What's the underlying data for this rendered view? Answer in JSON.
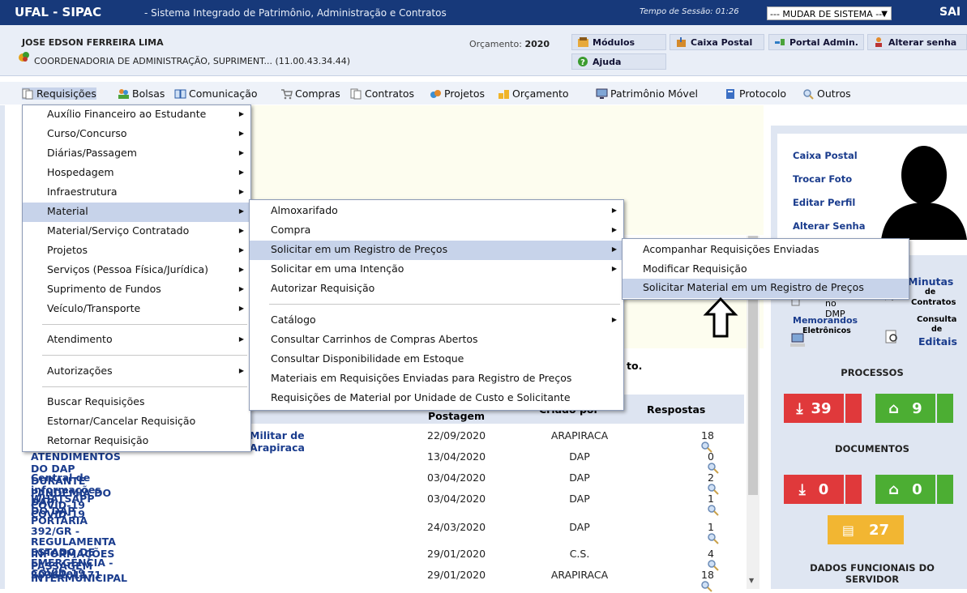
{
  "topbar": {
    "title": "UFAL - SIPAC",
    "subtitle": "- Sistema Integrado de Patrimônio, Administração e Contratos",
    "session": "Tempo de Sessão: 01:26",
    "system_select": "--- MUDAR DE SISTEMA ---",
    "exit": "SAI"
  },
  "user": {
    "name": "JOSE EDSON FERREIRA LIMA",
    "unit": "COORDENADORIA DE ADMINISTRAÇÃO, SUPRIMENT... (11.00.43.34.44)",
    "budget_label": "Orçamento:",
    "budget_year": "2020"
  },
  "toolbar": {
    "modulos": "Módulos",
    "caixa_postal": "Caixa Postal",
    "portal_admin": "Portal Admin.",
    "alterar_senha": "Alterar senha",
    "ajuda": "Ajuda"
  },
  "menubar": [
    "Requisições",
    "Bolsas",
    "Comunicação",
    "Compras",
    "Contratos",
    "Projetos",
    "Orçamento",
    "Patrimônio Móvel",
    "Protocolo",
    "Outros"
  ],
  "menu1": [
    "Auxílio Financeiro ao Estudante",
    "Curso/Concurso",
    "Diárias/Passagem",
    "Hospedagem",
    "Infraestrutura",
    "Material",
    "Material/Serviço Contratado",
    "Projetos",
    "Serviços (Pessoa Física/Jurídica)",
    "Suprimento de Fundos",
    "Veículo/Transporte",
    "Atendimento",
    "Autorizações",
    "Buscar Requisições",
    "Estornar/Cancelar Requisição",
    "Retornar Requisição"
  ],
  "menu2": [
    "Almoxarifado",
    "Compra",
    "Solicitar em um Registro de Preços",
    "Solicitar em uma Intenção",
    "Autorizar Requisição",
    "Catálogo",
    "Consultar Carrinhos de Compras Abertos",
    "Consultar Disponibilidade em Estoque",
    "Materiais em Requisições Enviadas para Registro de Preços",
    "Requisições de Material por Unidade de Custo e Solicitante"
  ],
  "menu3": [
    "Acompanhar Requisições Enviadas",
    "Modificar Requisição",
    "Solicitar Material em um Registro de Preços"
  ],
  "content": {
    "partial_text": "to.",
    "headers": {
      "postagem": "Postagem",
      "criado_por": "Criado por",
      "respostas": "Respostas"
    },
    "rows": [
      {
        "title": "Militar de Arapiraca",
        "date": "22/09/2020",
        "by": "ARAPIRACA",
        "replies": "18"
      },
      {
        "title": "ATENDIMENTOS DO DAP DURANTE PANDEMIA DO COVID-19",
        "date": "13/04/2020",
        "by": "DAP",
        "replies": "0"
      },
      {
        "title": "Central de informações DAP - COVID-19",
        "date": "03/04/2020",
        "by": "DAP",
        "replies": "2"
      },
      {
        "title": "WHATSAPP DO DAP",
        "date": "03/04/2020",
        "by": "DAP",
        "replies": "1"
      },
      {
        "title": "PORTARIA 392/GR - REGULAMENTA ESTADO DE",
        "title2": "EMERGÊNCIA - COVID-19",
        "date": "24/03/2020",
        "by": "DAP",
        "replies": "1"
      },
      {
        "title": "INFORMAÇÕES PASSAGEM INTERMUNICIPAL",
        "date": "29/01/2020",
        "by": "C.S.",
        "replies": "4"
      },
      {
        "title": "3036101171",
        "date": "29/01/2020",
        "by": "ARAPIRACA",
        "replies": "18"
      }
    ]
  },
  "right": {
    "links": [
      "Caixa Postal",
      "Trocar Foto",
      "Editar Perfil",
      "Alterar Senha"
    ],
    "no_dmp": "no DMP",
    "minutas": "Minutas",
    "de": "de",
    "contratos": "Contratos",
    "memorandos": "Memorandos",
    "eletronicos": "Eletrônicos",
    "consulta": "Consulta",
    "editais": "Editais",
    "processos": "PROCESSOS",
    "proc_in": "39",
    "proc_home": "9",
    "documentos": "DOCUMENTOS",
    "doc_in": "0",
    "doc_home": "0",
    "doc_pending": "27",
    "dados": "DADOS FUNCIONAIS DO",
    "servidor": "SERVIDOR"
  },
  "colors": {
    "topbar": "#17397a",
    "highlight": "#c7d3ea",
    "red": "#e0393b",
    "green": "#4cae33",
    "amber": "#f2b632",
    "link": "#1a3c8d"
  }
}
